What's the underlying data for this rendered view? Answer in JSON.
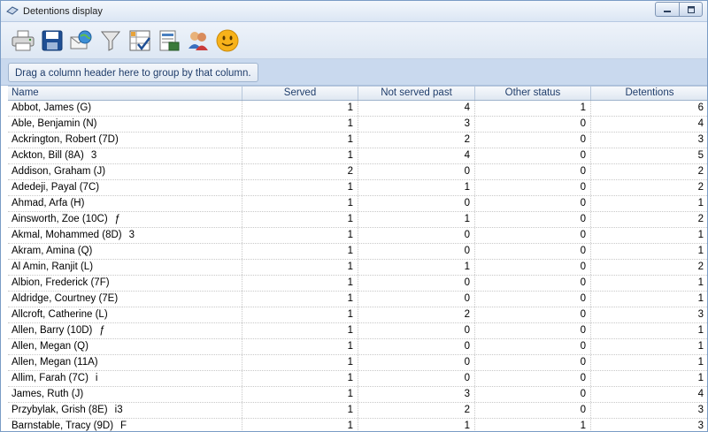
{
  "window": {
    "title": "Detentions display"
  },
  "toolbar": {
    "icons": [
      "printer-icon",
      "save-icon",
      "email-globe-icon",
      "filter-icon",
      "checklist-icon",
      "export-icon",
      "users-icon",
      "smiley-icon"
    ]
  },
  "group_panel": {
    "text": "Drag a column header here to group by that column."
  },
  "grid": {
    "columns": [
      "Name",
      "Served",
      "Not served past",
      "Other status",
      "Detentions"
    ],
    "rows": [
      {
        "name": "Abbot, James (G)",
        "mark": "",
        "served": "1",
        "not_served_past": "4",
        "other_status": "1",
        "detentions": "6"
      },
      {
        "name": "Able, Benjamin (N)",
        "mark": "",
        "served": "1",
        "not_served_past": "3",
        "other_status": "0",
        "detentions": "4"
      },
      {
        "name": "Ackrington, Robert (7D)",
        "mark": "",
        "served": "1",
        "not_served_past": "2",
        "other_status": "0",
        "detentions": "3"
      },
      {
        "name": "Ackton, Bill (8A)",
        "mark": "3",
        "served": "1",
        "not_served_past": "4",
        "other_status": "0",
        "detentions": "5"
      },
      {
        "name": "Addison, Graham (J)",
        "mark": "",
        "served": "2",
        "not_served_past": "0",
        "other_status": "0",
        "detentions": "2"
      },
      {
        "name": "Adedeji, Payal (7C)",
        "mark": "",
        "served": "1",
        "not_served_past": "1",
        "other_status": "0",
        "detentions": "2"
      },
      {
        "name": "Ahmad, Arfa (H)",
        "mark": "",
        "served": "1",
        "not_served_past": "0",
        "other_status": "0",
        "detentions": "1"
      },
      {
        "name": "Ainsworth, Zoe (10C)",
        "mark": "ƒ",
        "served": "1",
        "not_served_past": "1",
        "other_status": "0",
        "detentions": "2"
      },
      {
        "name": "Akmal, Mohammed (8D)",
        "mark": "3",
        "served": "1",
        "not_served_past": "0",
        "other_status": "0",
        "detentions": "1"
      },
      {
        "name": "Akram, Amina (Q)",
        "mark": "",
        "served": "1",
        "not_served_past": "0",
        "other_status": "0",
        "detentions": "1"
      },
      {
        "name": "Al Amin, Ranjit (L)",
        "mark": "",
        "served": "1",
        "not_served_past": "1",
        "other_status": "0",
        "detentions": "2"
      },
      {
        "name": "Albion, Frederick (7F)",
        "mark": "",
        "served": "1",
        "not_served_past": "0",
        "other_status": "0",
        "detentions": "1"
      },
      {
        "name": "Aldridge, Courtney (7E)",
        "mark": "",
        "served": "1",
        "not_served_past": "0",
        "other_status": "0",
        "detentions": "1"
      },
      {
        "name": "Allcroft, Catherine (L)",
        "mark": "",
        "served": "1",
        "not_served_past": "2",
        "other_status": "0",
        "detentions": "3"
      },
      {
        "name": "Allen, Barry (10D)",
        "mark": "ƒ",
        "served": "1",
        "not_served_past": "0",
        "other_status": "0",
        "detentions": "1"
      },
      {
        "name": "Allen, Megan (Q)",
        "mark": "",
        "served": "1",
        "not_served_past": "0",
        "other_status": "0",
        "detentions": "1"
      },
      {
        "name": "Allen, Megan (11A)",
        "mark": "",
        "served": "1",
        "not_served_past": "0",
        "other_status": "0",
        "detentions": "1"
      },
      {
        "name": "Allim, Farah (7C)",
        "mark": "i",
        "served": "1",
        "not_served_past": "0",
        "other_status": "0",
        "detentions": "1"
      },
      {
        "name": "James, Ruth (J)",
        "mark": "",
        "served": "1",
        "not_served_past": "3",
        "other_status": "0",
        "detentions": "4"
      },
      {
        "name": "Przybylak, Grish (8E)",
        "mark": "i3",
        "served": "1",
        "not_served_past": "2",
        "other_status": "0",
        "detentions": "3"
      },
      {
        "name": "Barnstable, Tracy (9D)",
        "mark": "F",
        "served": "1",
        "not_served_past": "1",
        "other_status": "1",
        "detentions": "3"
      }
    ]
  }
}
